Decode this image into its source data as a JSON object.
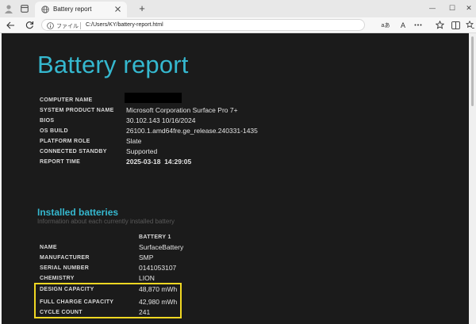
{
  "browser": {
    "tab_title": "Battery report",
    "address_label": "ファイル",
    "url": "C:/Users/KY/battery-report.html",
    "new_tab_symbol": "+",
    "reader_symbol": "aあ",
    "read_aloud_symbol": "A",
    "minimize_symbol": "—",
    "maximize_symbol": "☐",
    "close_symbol": "✕"
  },
  "report": {
    "title": "Battery report",
    "system_info": [
      {
        "label": "COMPUTER NAME",
        "value": ""
      },
      {
        "label": "SYSTEM PRODUCT NAME",
        "value": "Microsoft Corporation Surface Pro 7+"
      },
      {
        "label": "BIOS",
        "value": "30.102.143 10/16/2024"
      },
      {
        "label": "OS BUILD",
        "value": "26100.1.amd64fre.ge_release.240331-1435"
      },
      {
        "label": "PLATFORM ROLE",
        "value": "Slate"
      },
      {
        "label": "CONNECTED STANDBY",
        "value": "Supported"
      },
      {
        "label": "REPORT TIME",
        "value": "2025-03-18  14:29:05"
      }
    ],
    "installed": {
      "heading": "Installed batteries",
      "subheading": "Information about each currently installed battery",
      "column": "BATTERY 1",
      "rows": [
        {
          "label": "NAME",
          "value": "SurfaceBattery"
        },
        {
          "label": "MANUFACTURER",
          "value": "SMP"
        },
        {
          "label": "SERIAL NUMBER",
          "value": "0141053107"
        },
        {
          "label": "CHEMISTRY",
          "value": "LION"
        },
        {
          "label": "DESIGN CAPACITY",
          "value": "48,870 mWh"
        },
        {
          "label": "FULL CHARGE CAPACITY",
          "value": "42,980 mWh"
        },
        {
          "label": "CYCLE COUNT",
          "value": "241"
        }
      ]
    }
  },
  "colors": {
    "accent": "#35b8cf",
    "highlight": "#f0d722",
    "background": "#1b1b1b"
  }
}
